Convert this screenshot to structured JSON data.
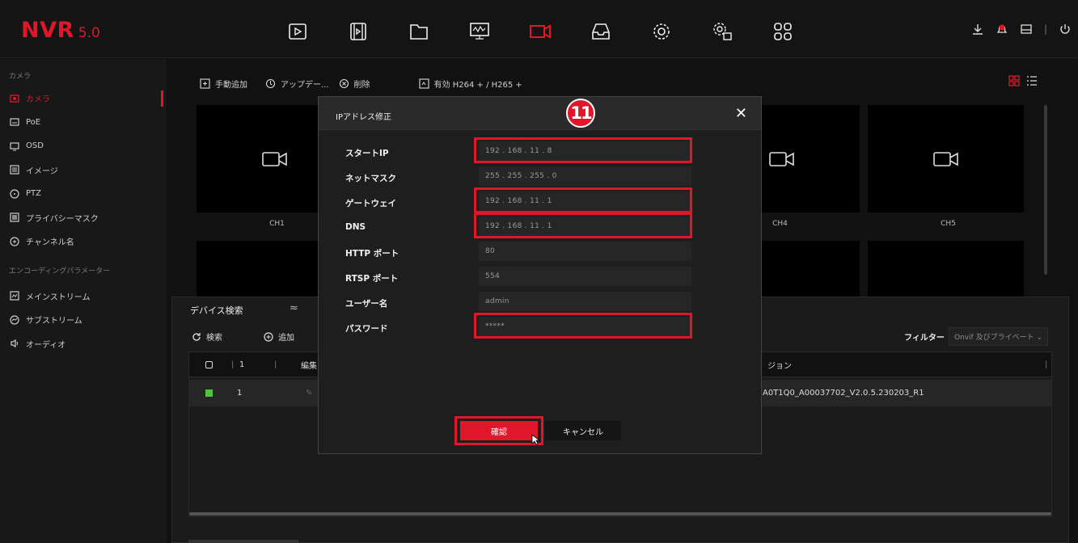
{
  "app": {
    "logo_text": "NVR",
    "logo_version": "5.0",
    "accent_color": "#e0162b"
  },
  "topbar": {
    "icons": [
      "playback-icon",
      "video-clip-icon",
      "folder-icon",
      "monitor-icon",
      "camera-icon",
      "storage-icon",
      "settings-icon",
      "advanced-settings-icon",
      "apps-icon"
    ],
    "active_icon": "camera-icon",
    "right_icons": [
      "download-icon",
      "alarm-icon",
      "disk-icon",
      "power-icon"
    ]
  },
  "sidebar": {
    "section1": "カメラ",
    "items": [
      {
        "label": "カメラ",
        "icon": "camera-icon"
      },
      {
        "label": "PoE",
        "icon": "poe-icon"
      },
      {
        "label": "OSD",
        "icon": "osd-icon"
      },
      {
        "label": "イメージ",
        "icon": "image-icon"
      },
      {
        "label": "PTZ",
        "icon": "ptz-icon"
      },
      {
        "label": "プライバシーマスク",
        "icon": "privacy-mask-icon"
      },
      {
        "label": "チャンネル名",
        "icon": "channel-name-icon"
      }
    ],
    "section2": "エンコーディングパラメーター",
    "items2": [
      {
        "label": "メインストリーム",
        "icon": "mainstream-icon"
      },
      {
        "label": "サブストリーム",
        "icon": "substream-icon"
      },
      {
        "label": "オーディオ",
        "icon": "audio-icon"
      }
    ]
  },
  "toolbar": {
    "manual_add": "手動追加",
    "update": "アップデー...",
    "delete": "削除",
    "h264": "有効 H264 + / H265 +"
  },
  "channels": [
    "CH1",
    "CH4",
    "CH5"
  ],
  "device_search": {
    "title": "デバイス検索",
    "search": "検索",
    "add": "追加",
    "filter_label": "フィルター",
    "filter_value": "Onvif 及びプライベート",
    "col_index": "1",
    "col_edit": "編集",
    "col_version": "ジョン",
    "row_index": "1",
    "row_version": "A0T1Q0_A00037702_V2.0.5.230203_R1"
  },
  "modal": {
    "title": "IPアドレス修正",
    "step_number": "11",
    "fields": [
      {
        "label": "スタートIP",
        "value": "192  .  168  .  11  .  8"
      },
      {
        "label": "ネットマスク",
        "value": "255  .  255  .  255  .  0"
      },
      {
        "label": "ゲートウェイ",
        "value": "192  .  168  .  11  .  1"
      },
      {
        "label": "DNS",
        "value": "192  .  168  .  11  .  1"
      },
      {
        "label": "HTTP ポート",
        "value": "80"
      },
      {
        "label": "RTSP ポート",
        "value": "554"
      },
      {
        "label": "ユーザー名",
        "value": "admin"
      },
      {
        "label": "パスワード",
        "value": "*****"
      }
    ],
    "ok": "確認",
    "cancel": "キャンセル"
  }
}
